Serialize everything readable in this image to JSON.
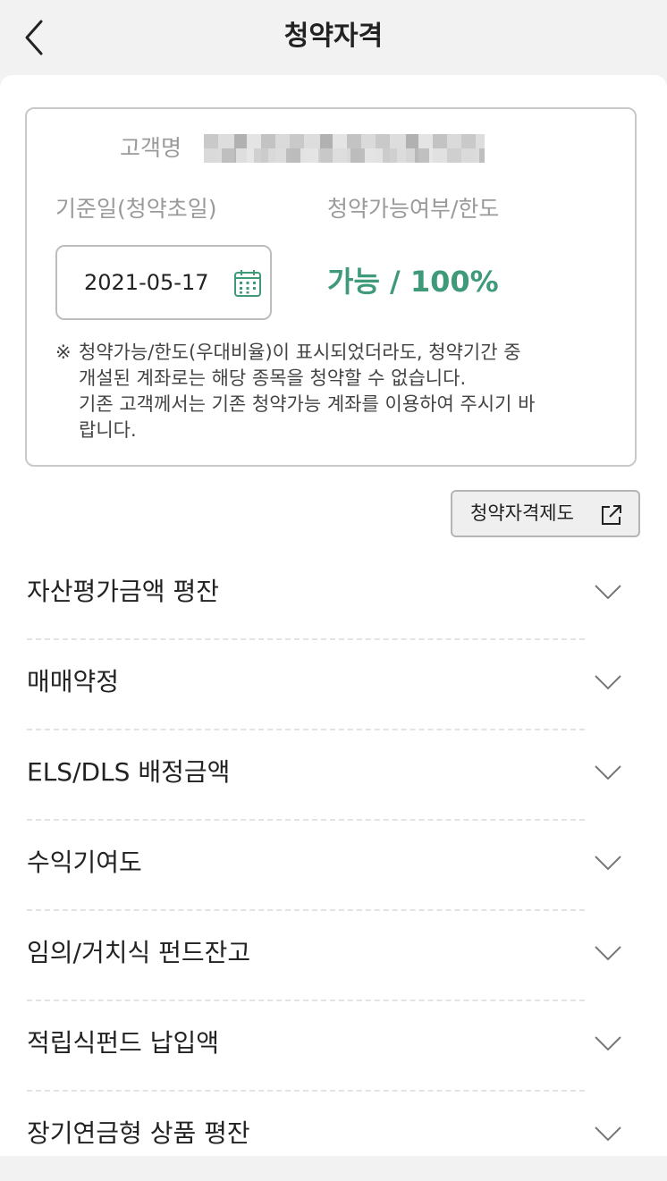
{
  "header": {
    "title": "청약자격",
    "back_icon": "chevron-left-icon"
  },
  "info": {
    "customer_label": "고객명",
    "date_label": "기준일(청약초일)",
    "date_value": "2021-05-17",
    "availability_label": "청약가능여부/한도",
    "availability_value": "가능 / 100%",
    "availability_color": "#3f9a7a",
    "notice_mark": "※",
    "notice_text": "청약가능/한도(우대비율)이 표시되었더라도, 청약기간 중\n개설된 계좌로는 해당 종목을 청약할 수 없습니다.\n기존 고객께서는 기존 청약가능 계좌를 이용하여 주시기 바\n랍니다."
  },
  "policy_button": {
    "label": "청약자격제도",
    "icon": "external-link-icon"
  },
  "accordion": [
    {
      "label": "자산평가금액 평잔"
    },
    {
      "label": "매매약정"
    },
    {
      "label": "ELS/DLS 배정금액"
    },
    {
      "label": "수익기여도"
    },
    {
      "label": "임의/거치식 펀드잔고"
    },
    {
      "label": "적립식펀드 납입액"
    },
    {
      "label": "장기연금형 상품 평잔"
    }
  ]
}
